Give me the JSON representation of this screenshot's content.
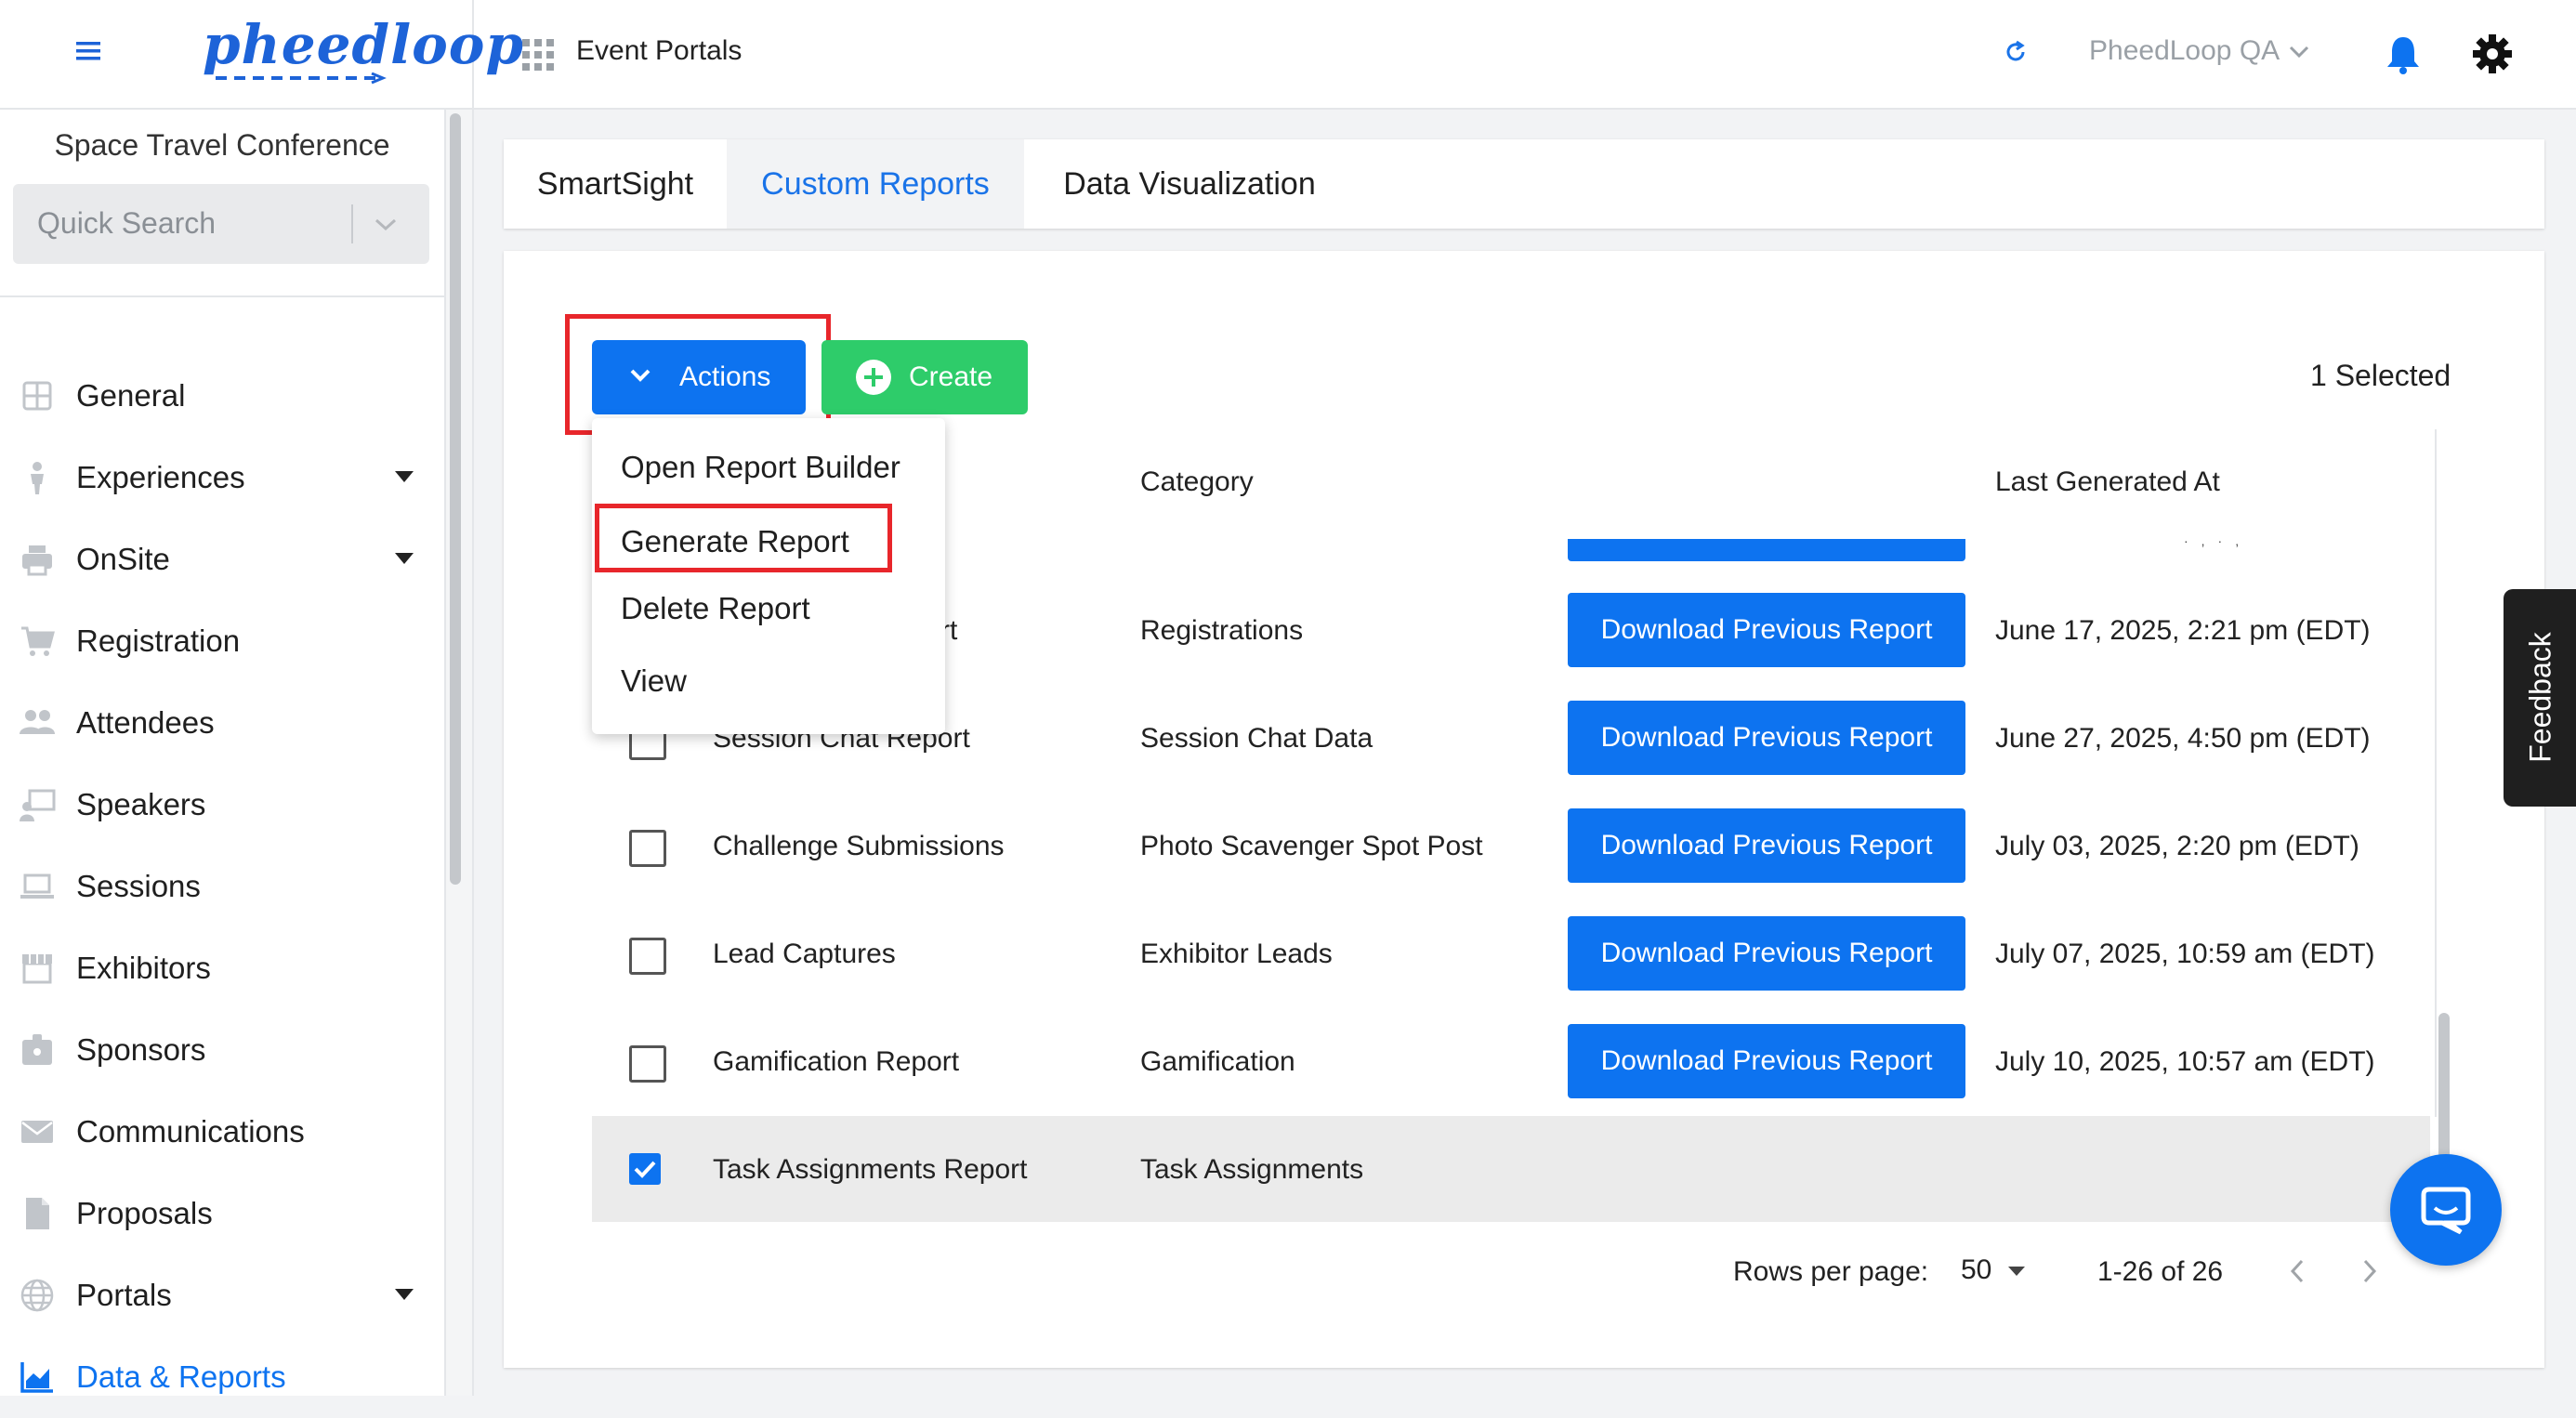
{
  "topbar": {
    "logo_text": "pheedloop",
    "section_title": "Event Portals",
    "account_name": "PheedLoop QA",
    "icons": [
      "hamburger-icon",
      "grid-icon",
      "refresh-icon",
      "chevron-down-icon",
      "bell-icon",
      "gear-icon"
    ]
  },
  "sidebar": {
    "event_name": "Space Travel Conference",
    "search_placeholder": "Quick Search",
    "items": [
      {
        "label": "General",
        "icon": "grid-icon",
        "expandable": false
      },
      {
        "label": "Experiences",
        "icon": "person-icon",
        "expandable": true
      },
      {
        "label": "OnSite",
        "icon": "printer-icon",
        "expandable": true
      },
      {
        "label": "Registration",
        "icon": "cart-icon",
        "expandable": false
      },
      {
        "label": "Attendees",
        "icon": "people-icon",
        "expandable": false
      },
      {
        "label": "Speakers",
        "icon": "presenter-icon",
        "expandable": false
      },
      {
        "label": "Sessions",
        "icon": "laptop-icon",
        "expandable": false
      },
      {
        "label": "Exhibitors",
        "icon": "storefront-icon",
        "expandable": false
      },
      {
        "label": "Sponsors",
        "icon": "badge-icon",
        "expandable": false
      },
      {
        "label": "Communications",
        "icon": "mail-icon",
        "expandable": false
      },
      {
        "label": "Proposals",
        "icon": "document-icon",
        "expandable": false
      },
      {
        "label": "Portals",
        "icon": "globe-icon",
        "expandable": true
      },
      {
        "label": "Data & Reports",
        "icon": "chart-icon",
        "expandable": false,
        "active": true
      }
    ]
  },
  "tabs": [
    {
      "label": "SmartSight",
      "active": false
    },
    {
      "label": "Custom Reports",
      "active": true
    },
    {
      "label": "Data Visualization",
      "active": false
    }
  ],
  "toolbar": {
    "actions_label": "Actions",
    "create_label": "Create",
    "selected_text": "1 Selected"
  },
  "actions_menu": {
    "items": [
      "Open Report Builder",
      "Generate Report",
      "Delete Report",
      "View"
    ],
    "highlighted": "Generate Report"
  },
  "table": {
    "headers": {
      "category": "Category",
      "last_generated": "Last Generated At"
    },
    "download_label": "Download Previous Report",
    "rows": [
      {
        "name": "rt",
        "category": "Registrations",
        "last": "June 17, 2025, 2:21 pm (EDT)",
        "checked": false
      },
      {
        "name": "Session Chat Report",
        "category": "Session Chat Data",
        "last": "June 27, 2025, 4:50 pm (EDT)",
        "checked": false
      },
      {
        "name": "Challenge Submissions",
        "category": "Photo Scavenger Spot Post",
        "last": "July 03, 2025, 2:20 pm (EDT)",
        "checked": false
      },
      {
        "name": "Lead Captures",
        "category": "Exhibitor Leads",
        "last": "July 07, 2025, 10:59 am (EDT)",
        "checked": false
      },
      {
        "name": "Gamification Report",
        "category": "Gamification",
        "last": "July 10, 2025, 10:57 am (EDT)",
        "checked": false
      },
      {
        "name": "Task Assignments Report",
        "category": "Task Assignments",
        "last": "",
        "checked": true
      }
    ]
  },
  "pagination": {
    "rows_per_page_label": "Rows per page:",
    "rows_per_page_value": "50",
    "range_text": "1-26 of 26"
  },
  "feedback_label": "Feedback",
  "colors": {
    "accent": "#0d73f0",
    "create": "#2ecc6a",
    "highlight_box": "#e8262b",
    "selected_row": "#ebebeb"
  }
}
